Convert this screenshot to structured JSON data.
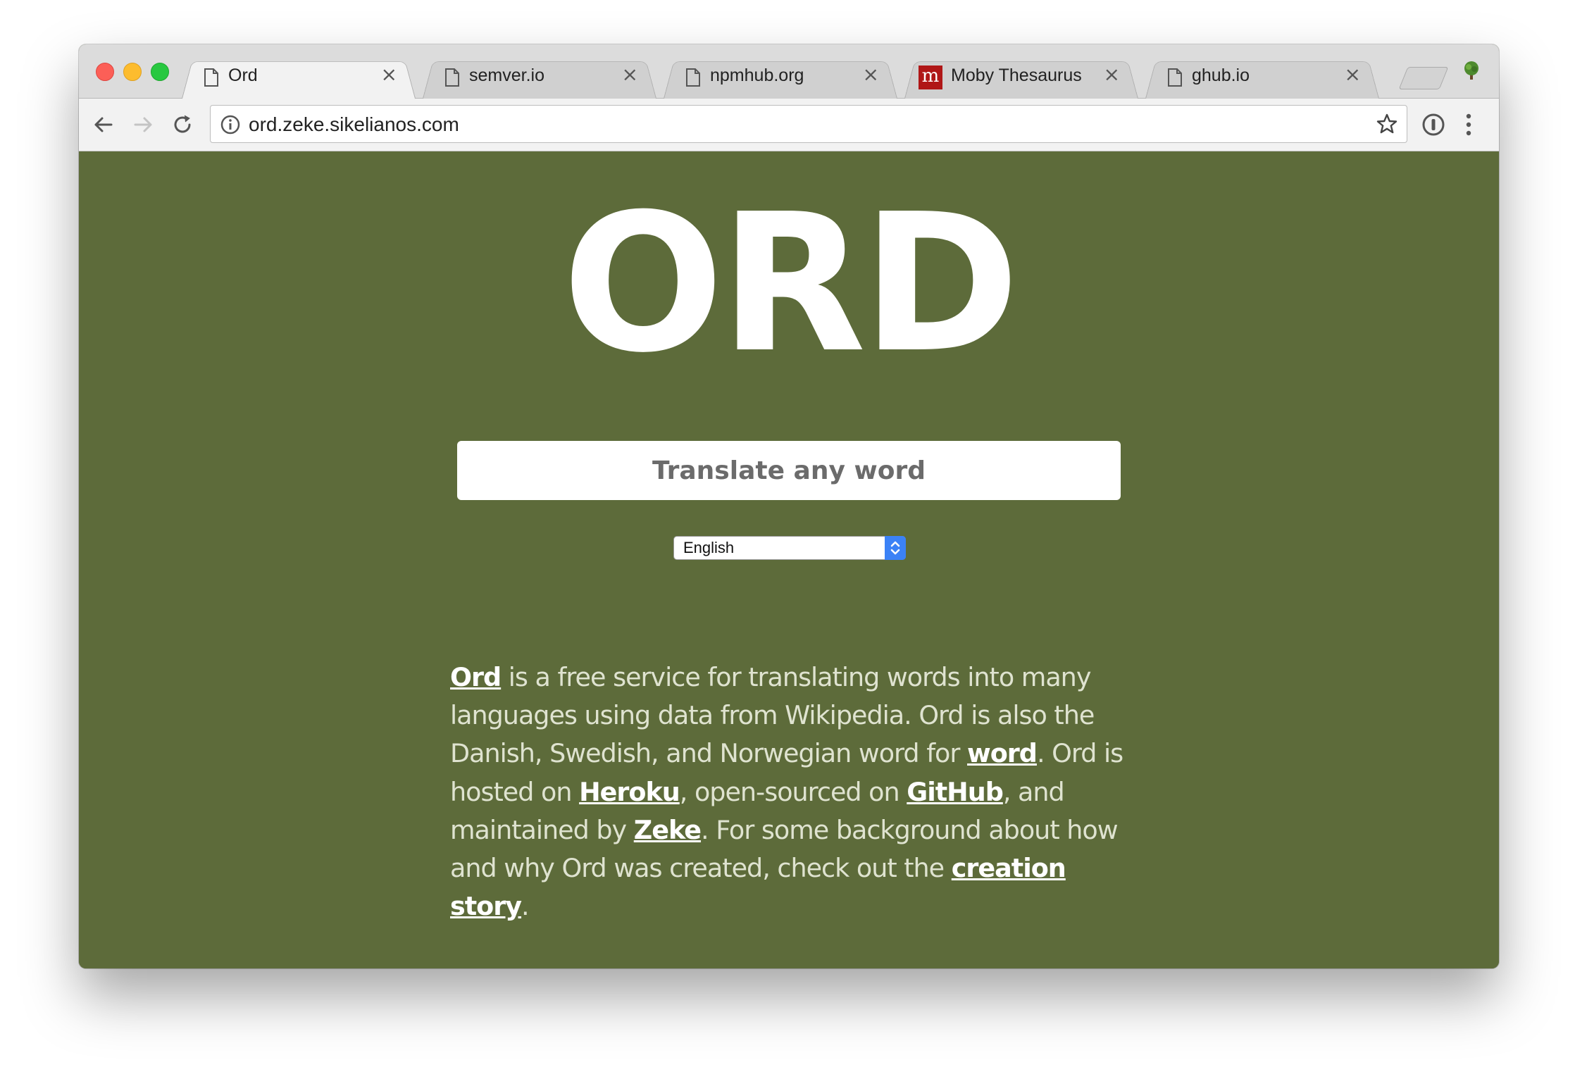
{
  "browser": {
    "tabs": [
      {
        "title": "Ord",
        "icon": "document-icon",
        "active": true
      },
      {
        "title": "semver.io",
        "icon": "document-icon",
        "active": false
      },
      {
        "title": "npmhub.org",
        "icon": "document-icon",
        "active": false
      },
      {
        "title": "Moby Thesaurus",
        "icon": "moby-m-icon",
        "active": false
      },
      {
        "title": "ghub.io",
        "icon": "document-icon",
        "active": false
      }
    ],
    "close_glyph": "×",
    "moby_letter": "m",
    "url": "ord.zeke.sikelianos.com"
  },
  "page": {
    "logo": "ORD",
    "search_placeholder": "Translate any word",
    "language_selected": "English",
    "description": {
      "link_ord": "Ord",
      "t1": " is a free service for translating words into many languages using data from Wikipedia. Ord is also the Danish, Swedish, and Norwegian word for ",
      "link_word": "word",
      "t2": ". Ord is hosted on ",
      "link_heroku": "Heroku",
      "t3": ", open-sourced on ",
      "link_github": "GitHub",
      "t4": ", and maintained by ",
      "link_zeke": "Zeke",
      "t5": ". For some background about how and why Ord was created, check out the ",
      "link_story": "creation story",
      "t6": "."
    }
  },
  "colors": {
    "page_background": "#5d6b3a",
    "link": "#ffffff",
    "text": "#dfe3d0",
    "select_accent": "#3b82f6"
  }
}
